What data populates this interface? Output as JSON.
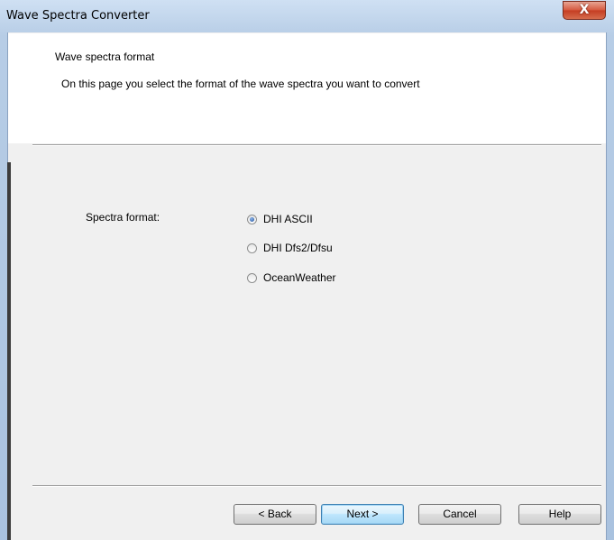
{
  "window": {
    "title": "Wave Spectra Converter",
    "close_glyph": "X"
  },
  "page": {
    "title": "Wave spectra format",
    "subtitle": "On this page you select the format of the wave spectra you want to convert"
  },
  "form": {
    "label": "Spectra format:",
    "options": [
      {
        "label": "DHI ASCII",
        "checked": true
      },
      {
        "label": "DHI Dfs2/Dfsu",
        "checked": false
      },
      {
        "label": "OceanWeather",
        "checked": false
      }
    ]
  },
  "buttons": {
    "back": "< Back",
    "next": "Next >",
    "cancel": "Cancel",
    "help": "Help"
  },
  "colors": {
    "accent": "#3c7fb1",
    "close": "#c43d22"
  },
  "icons": {
    "close": "close-icon"
  }
}
